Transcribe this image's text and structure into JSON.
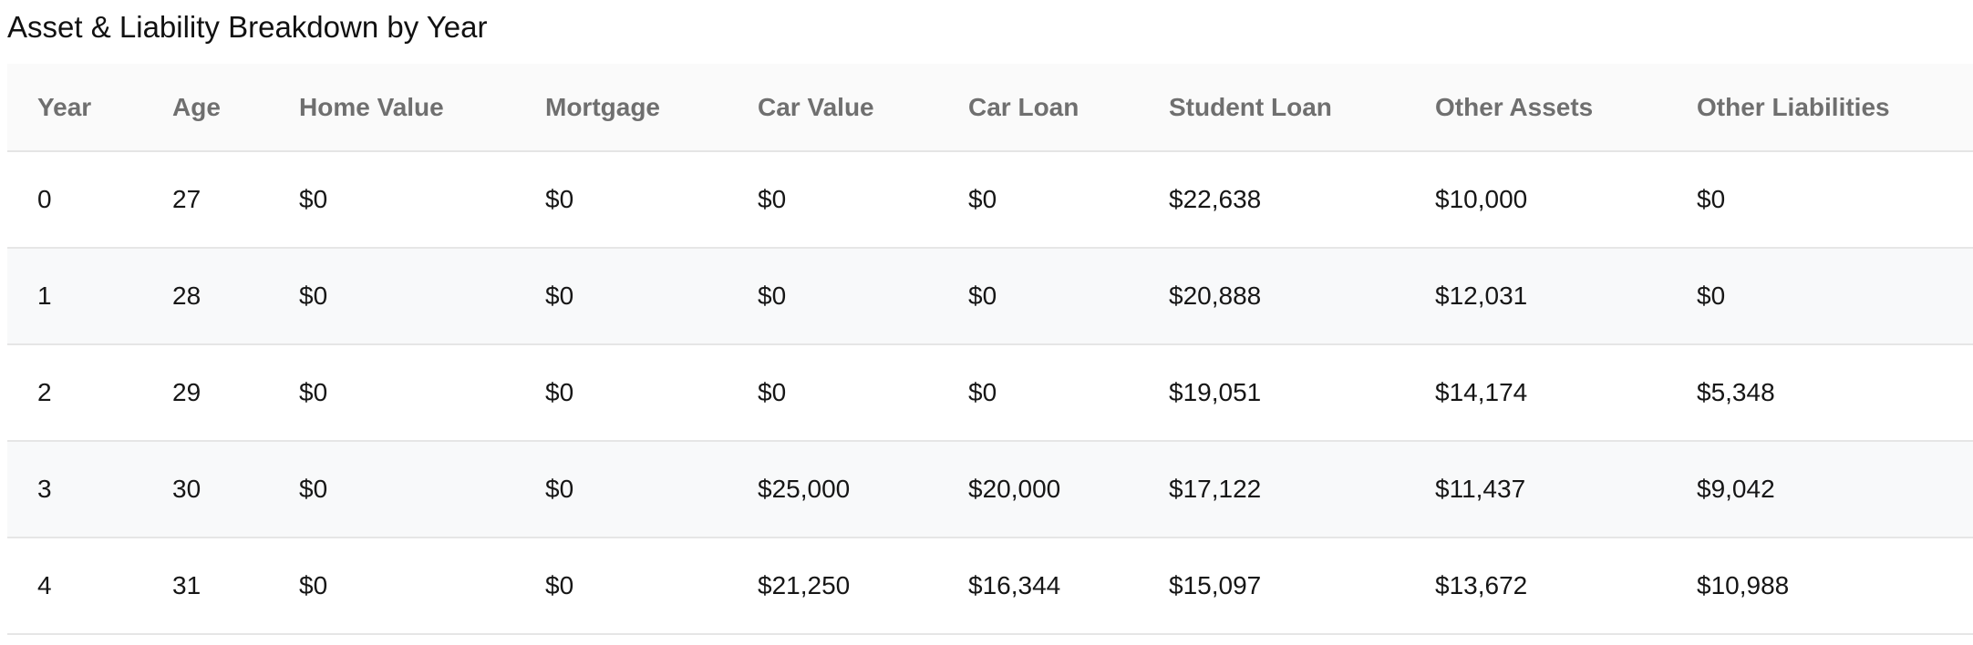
{
  "title": "Asset & Liability Breakdown by Year",
  "columns": [
    "Year",
    "Age",
    "Home Value",
    "Mortgage",
    "Car Value",
    "Car Loan",
    "Student Loan",
    "Other Assets",
    "Other Liabilities"
  ],
  "rows": [
    [
      "0",
      "27",
      "$0",
      "$0",
      "$0",
      "$0",
      "$22,638",
      "$10,000",
      "$0"
    ],
    [
      "1",
      "28",
      "$0",
      "$0",
      "$0",
      "$0",
      "$20,888",
      "$12,031",
      "$0"
    ],
    [
      "2",
      "29",
      "$0",
      "$0",
      "$0",
      "$0",
      "$19,051",
      "$14,174",
      "$5,348"
    ],
    [
      "3",
      "30",
      "$0",
      "$0",
      "$25,000",
      "$20,000",
      "$17,122",
      "$11,437",
      "$9,042"
    ],
    [
      "4",
      "31",
      "$0",
      "$0",
      "$21,250",
      "$16,344",
      "$15,097",
      "$13,672",
      "$10,988"
    ]
  ]
}
